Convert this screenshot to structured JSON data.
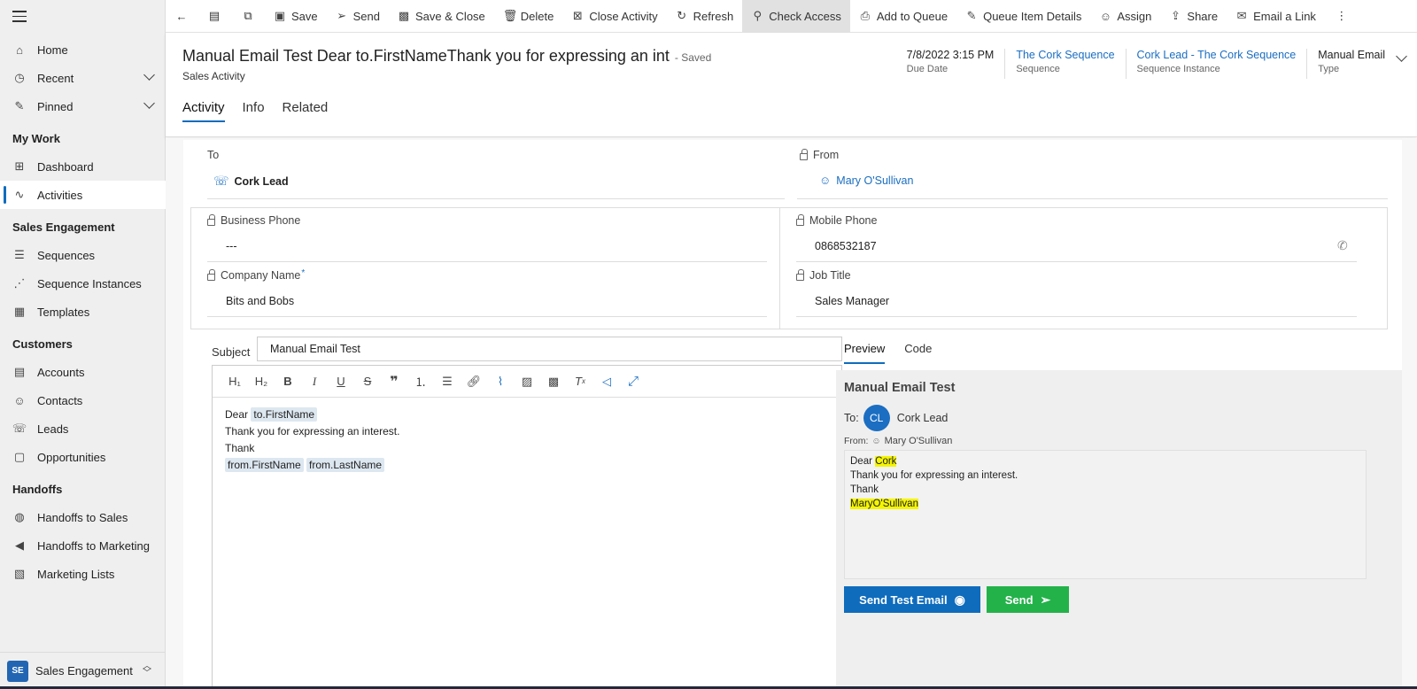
{
  "sidebar": {
    "home": "Home",
    "recent": "Recent",
    "pinned": "Pinned",
    "groups": {
      "my_work": "My Work",
      "sales_engagement": "Sales Engagement",
      "customers": "Customers",
      "handoffs": "Handoffs"
    },
    "items": {
      "dashboard": "Dashboard",
      "activities": "Activities",
      "sequences": "Sequences",
      "sequence_instances": "Sequence Instances",
      "templates": "Templates",
      "accounts": "Accounts",
      "contacts": "Contacts",
      "leads": "Leads",
      "opportunities": "Opportunities",
      "handoffs_to_sales": "Handoffs to Sales",
      "handoffs_to_marketing": "Handoffs to Marketing",
      "marketing_lists": "Marketing Lists"
    },
    "area": {
      "badge": "SE",
      "label": "Sales Engagement"
    }
  },
  "commands": {
    "save": "Save",
    "send": "Send",
    "save_close": "Save & Close",
    "delete": "Delete",
    "close_activity": "Close Activity",
    "refresh": "Refresh",
    "check_access": "Check Access",
    "add_to_queue": "Add to Queue",
    "queue_item_details": "Queue Item Details",
    "assign": "Assign",
    "share": "Share",
    "email_link": "Email a Link"
  },
  "header": {
    "title": "Manual Email Test  Dear to.FirstNameThank you for expressing an int",
    "saved": "- Saved",
    "subtitle": "Sales Activity",
    "fields": [
      {
        "value": "7/8/2022 3:15 PM",
        "label": "Due Date"
      },
      {
        "value": "The Cork Sequence",
        "label": "Sequence"
      },
      {
        "value": "Cork Lead - The Cork Sequence",
        "label": "Sequence Instance"
      },
      {
        "value": "Manual Email",
        "label": "Type"
      }
    ],
    "tabs": [
      "Activity",
      "Info",
      "Related"
    ]
  },
  "form": {
    "to_label": "To",
    "to_value": "Cork Lead",
    "from_label": "From",
    "from_value": "Mary O'Sullivan",
    "business_phone_label": "Business Phone",
    "business_phone_value": "---",
    "mobile_phone_label": "Mobile Phone",
    "mobile_phone_value": "0868532187",
    "company_name_label": "Company Name",
    "required_mark": "*",
    "company_name_value": "Bits and Bobs",
    "job_title_label": "Job Title",
    "job_title_value": "Sales Manager"
  },
  "email": {
    "subject_label": "Subject",
    "subject_value": "Manual Email Test",
    "body": {
      "dear": "Dear",
      "token_first": "to.FirstName",
      "line2": "Thank you for expressing an interest.",
      "line3": "Thank",
      "token_from_first": "from.FirstName",
      "token_from_last": "from.LastName"
    }
  },
  "preview": {
    "tabs": [
      "Preview",
      "Code"
    ],
    "title": "Manual Email Test",
    "to_label": "To:",
    "avatar": "CL",
    "to_name": "Cork Lead",
    "from_label": "From:",
    "from_name": "Mary O'Sullivan",
    "body": {
      "dear": "Dear",
      "name": "Cork",
      "line2": "Thank you for expressing an interest.",
      "line3": "Thank",
      "signature": "MaryO'Sullivan"
    },
    "send_test": "Send Test Email",
    "send": "Send"
  },
  "colors": {
    "accent": "#0f6cbd",
    "send_green": "#23b24a",
    "highlight": "#f5f500"
  }
}
